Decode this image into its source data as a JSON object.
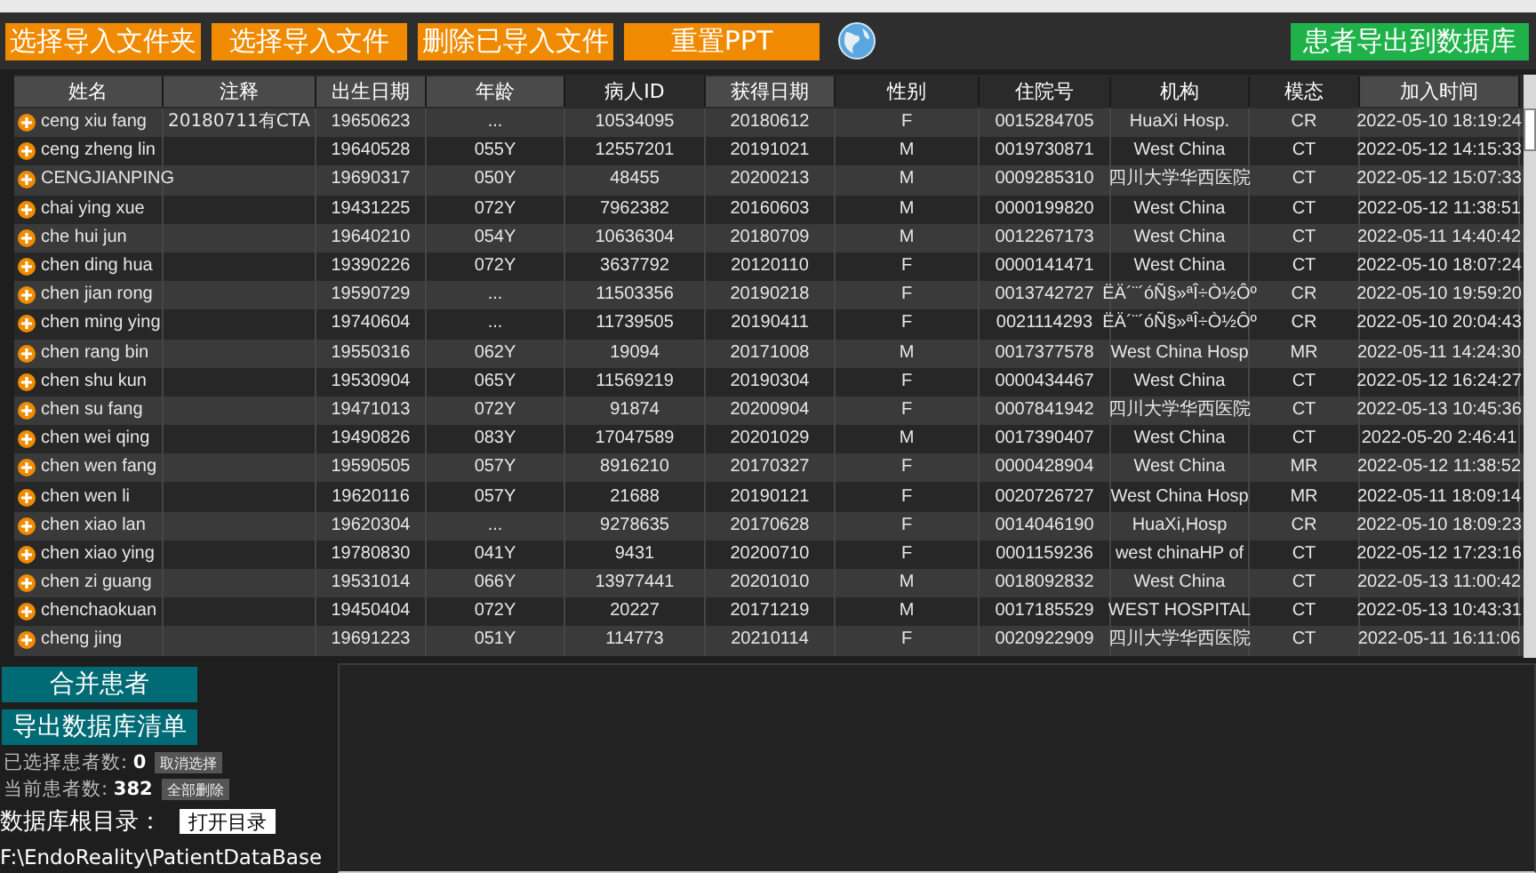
{
  "toolbar": {
    "buttons": [
      {
        "label": "选择导入文件夹",
        "kind": "import"
      },
      {
        "label": "选择导入文件",
        "kind": "import"
      },
      {
        "label": "删除已导入文件",
        "kind": "import"
      },
      {
        "label": "重置PPT",
        "kind": "import"
      },
      {
        "label": "患者导出到数据库",
        "kind": "export"
      }
    ]
  },
  "table": {
    "columns": [
      {
        "label": "姓名",
        "highlighted": true
      },
      {
        "label": "注释",
        "highlighted": true
      },
      {
        "label": "出生日期",
        "highlighted": true
      },
      {
        "label": "年龄",
        "highlighted": true
      },
      {
        "label": "病人ID",
        "highlighted": false
      },
      {
        "label": "获得日期",
        "highlighted": true
      },
      {
        "label": "性别",
        "highlighted": false
      },
      {
        "label": "住院号",
        "highlighted": false
      },
      {
        "label": "机构",
        "highlighted": false
      },
      {
        "label": "模态",
        "highlighted": false
      },
      {
        "label": "加入时间",
        "highlighted": true
      }
    ],
    "rows": [
      [
        "ceng xiu fang",
        "20180711有CTA",
        "19650623",
        "...",
        "10534095",
        "20180612",
        "F",
        "0015284705",
        "HuaXi Hosp.",
        "CR",
        "2022-05-10 18:19:24"
      ],
      [
        "ceng zheng lin",
        "",
        "19640528",
        "055Y",
        "12557201",
        "20191021",
        "M",
        "0019730871",
        "West China",
        "CT",
        "2022-05-12 14:15:33"
      ],
      [
        "CENGJIANPING",
        "",
        "19690317",
        "050Y",
        "48455",
        "20200213",
        "M",
        "0009285310",
        "四川大学华西医院",
        "CT",
        "2022-05-12 15:07:33"
      ],
      [
        "chai ying xue",
        "",
        "19431225",
        "072Y",
        "7962382",
        "20160603",
        "M",
        "0000199820",
        "West China",
        "CT",
        "2022-05-12 11:38:51"
      ],
      [
        "che hui jun",
        "",
        "19640210",
        "054Y",
        "10636304",
        "20180709",
        "M",
        "0012267173",
        "West China",
        "CT",
        "2022-05-11 14:40:42"
      ],
      [
        "chen ding hua",
        "",
        "19390226",
        "072Y",
        "3637792",
        "20120110",
        "F",
        "0000141471",
        "West China",
        "CT",
        "2022-05-10 18:07:24"
      ],
      [
        "chen jian rong",
        "",
        "19590729",
        "...",
        "11503356",
        "20190218",
        "F",
        "0013742727",
        "ËÄ´¨´óÑ§»ªÎ÷Ò½Ôº",
        "CR",
        "2022-05-10 19:59:20"
      ],
      [
        "chen ming ying",
        "",
        "19740604",
        "...",
        "11739505",
        "20190411",
        "F",
        "0021114293",
        "ËÄ´¨´óÑ§»ªÎ÷Ò½Ôº",
        "CR",
        "2022-05-10 20:04:43"
      ],
      [
        "chen rang bin",
        "",
        "19550316",
        "062Y",
        "19094",
        "20171008",
        "M",
        "0017377578",
        "West China Hosp",
        "MR",
        "2022-05-11 14:24:30"
      ],
      [
        "chen shu kun",
        "",
        "19530904",
        "065Y",
        "11569219",
        "20190304",
        "F",
        "0000434467",
        "West China",
        "CT",
        "2022-05-12 16:24:27"
      ],
      [
        "chen su fang",
        "",
        "19471013",
        "072Y",
        "91874",
        "20200904",
        "F",
        "0007841942",
        "四川大学华西医院",
        "CT",
        "2022-05-13 10:45:36"
      ],
      [
        "chen wei qing",
        "",
        "19490826",
        "083Y",
        "17047589",
        "20201029",
        "M",
        "0017390407",
        "West China",
        "CT",
        "2022-05-20 2:46:41"
      ],
      [
        "chen wen fang",
        "",
        "19590505",
        "057Y",
        "8916210",
        "20170327",
        "F",
        "0000428904",
        "West China",
        "MR",
        "2022-05-12 11:38:52"
      ],
      [
        "chen wen li",
        "",
        "19620116",
        "057Y",
        "21688",
        "20190121",
        "F",
        "0020726727",
        "West China Hosp",
        "MR",
        "2022-05-11 18:09:14"
      ],
      [
        "chen xiao lan",
        "",
        "19620304",
        "...",
        "9278635",
        "20170628",
        "F",
        "0014046190",
        "HuaXi,Hosp",
        "CR",
        "2022-05-10 18:09:23"
      ],
      [
        "chen xiao ying",
        "",
        "19780830",
        "041Y",
        "9431",
        "20200710",
        "F",
        "0001159236",
        "west chinaHP of",
        "CT",
        "2022-05-12 17:23:16"
      ],
      [
        "chen zi guang",
        "",
        "19531014",
        "066Y",
        "13977441",
        "20201010",
        "M",
        "0018092832",
        "West China",
        "CT",
        "2022-05-13 11:00:42"
      ],
      [
        "chenchaokuan",
        "",
        "19450404",
        "072Y",
        "20227",
        "20171219",
        "M",
        "0017185529",
        "WEST HOSPITAL",
        "CT",
        "2022-05-13 10:43:31"
      ],
      [
        "cheng jing",
        "",
        "19691223",
        "051Y",
        "114773",
        "20210114",
        "F",
        "0020922909",
        "四川大学华西医院",
        "CT",
        "2022-05-11 16:11:06"
      ]
    ]
  },
  "actions": {
    "merge_button": "合并患者",
    "export_list_button": "导出数据库清单"
  },
  "stats": [
    {
      "label": "已选择患者数:",
      "value": "0",
      "button": "取消选择"
    },
    {
      "label": "当前患者数:",
      "value": "382",
      "button": "全部删除"
    }
  ],
  "database": {
    "label": "数据库根目录：",
    "button": "打开目录",
    "path": "F:\\EndoReality\\PatientDataBase"
  }
}
